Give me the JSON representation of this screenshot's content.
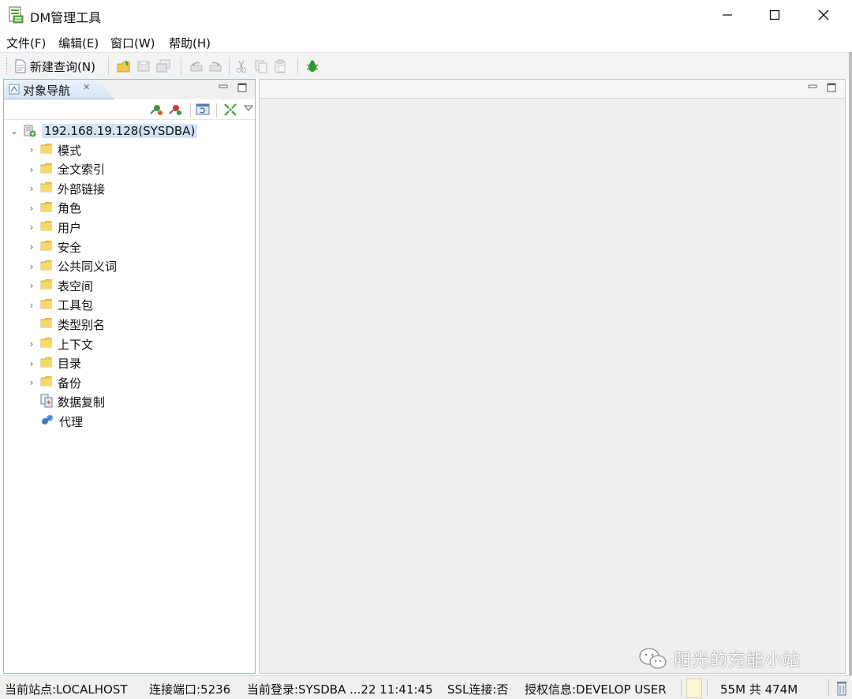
{
  "window": {
    "title": "DM管理工具",
    "icon": "dm-app-icon",
    "controls": [
      "minimize-icon",
      "maximize-icon",
      "close-icon"
    ]
  },
  "menu": {
    "items": [
      {
        "label": "文件(F)"
      },
      {
        "label": "编辑(E)"
      },
      {
        "label": "窗口(W)"
      },
      {
        "label": "帮助(H)"
      }
    ]
  },
  "toolbar": {
    "new_query_label": "新建查询(N)"
  },
  "navigator": {
    "tab_label": "对象导航",
    "tab_close": "✕",
    "root": {
      "label": "192.168.19.128(SYSDBA)",
      "expanded": true
    },
    "nodes": [
      {
        "label": "模式",
        "icon": "folder-icon",
        "expandable": true
      },
      {
        "label": "全文索引",
        "icon": "folder-icon",
        "expandable": true
      },
      {
        "label": "外部链接",
        "icon": "folder-icon",
        "expandable": true
      },
      {
        "label": "角色",
        "icon": "folder-icon",
        "expandable": true
      },
      {
        "label": "用户",
        "icon": "folder-icon",
        "expandable": true
      },
      {
        "label": "安全",
        "icon": "folder-icon",
        "expandable": true
      },
      {
        "label": "公共同义词",
        "icon": "folder-icon",
        "expandable": true
      },
      {
        "label": "表空间",
        "icon": "folder-icon",
        "expandable": true
      },
      {
        "label": "工具包",
        "icon": "folder-icon",
        "expandable": true
      },
      {
        "label": "类型别名",
        "icon": "folder-icon",
        "expandable": false
      },
      {
        "label": "上下文",
        "icon": "folder-icon",
        "expandable": true
      },
      {
        "label": "目录",
        "icon": "folder-icon",
        "expandable": true
      },
      {
        "label": "备份",
        "icon": "folder-icon",
        "expandable": true
      },
      {
        "label": "数据复制",
        "icon": "data-replication-icon",
        "expandable": false
      },
      {
        "label": "代理",
        "icon": "agent-icon",
        "expandable": false
      }
    ]
  },
  "statusbar": {
    "site": "当前站点:LOCALHOST",
    "port": "连接端口:5236",
    "login": "当前登录:SYSDBA ...22 11:41:45",
    "ssl": "SSL连接:否",
    "license": "授权信息:DEVELOP USER",
    "memory": "55M 共 474M"
  },
  "watermark": {
    "text": "阳光的充能小站"
  },
  "colors": {
    "nav_border": "#9fb7d5",
    "root_highlight": "#d5e4f5",
    "folder": "#f2c94c",
    "editor_bg": "#efefef"
  }
}
